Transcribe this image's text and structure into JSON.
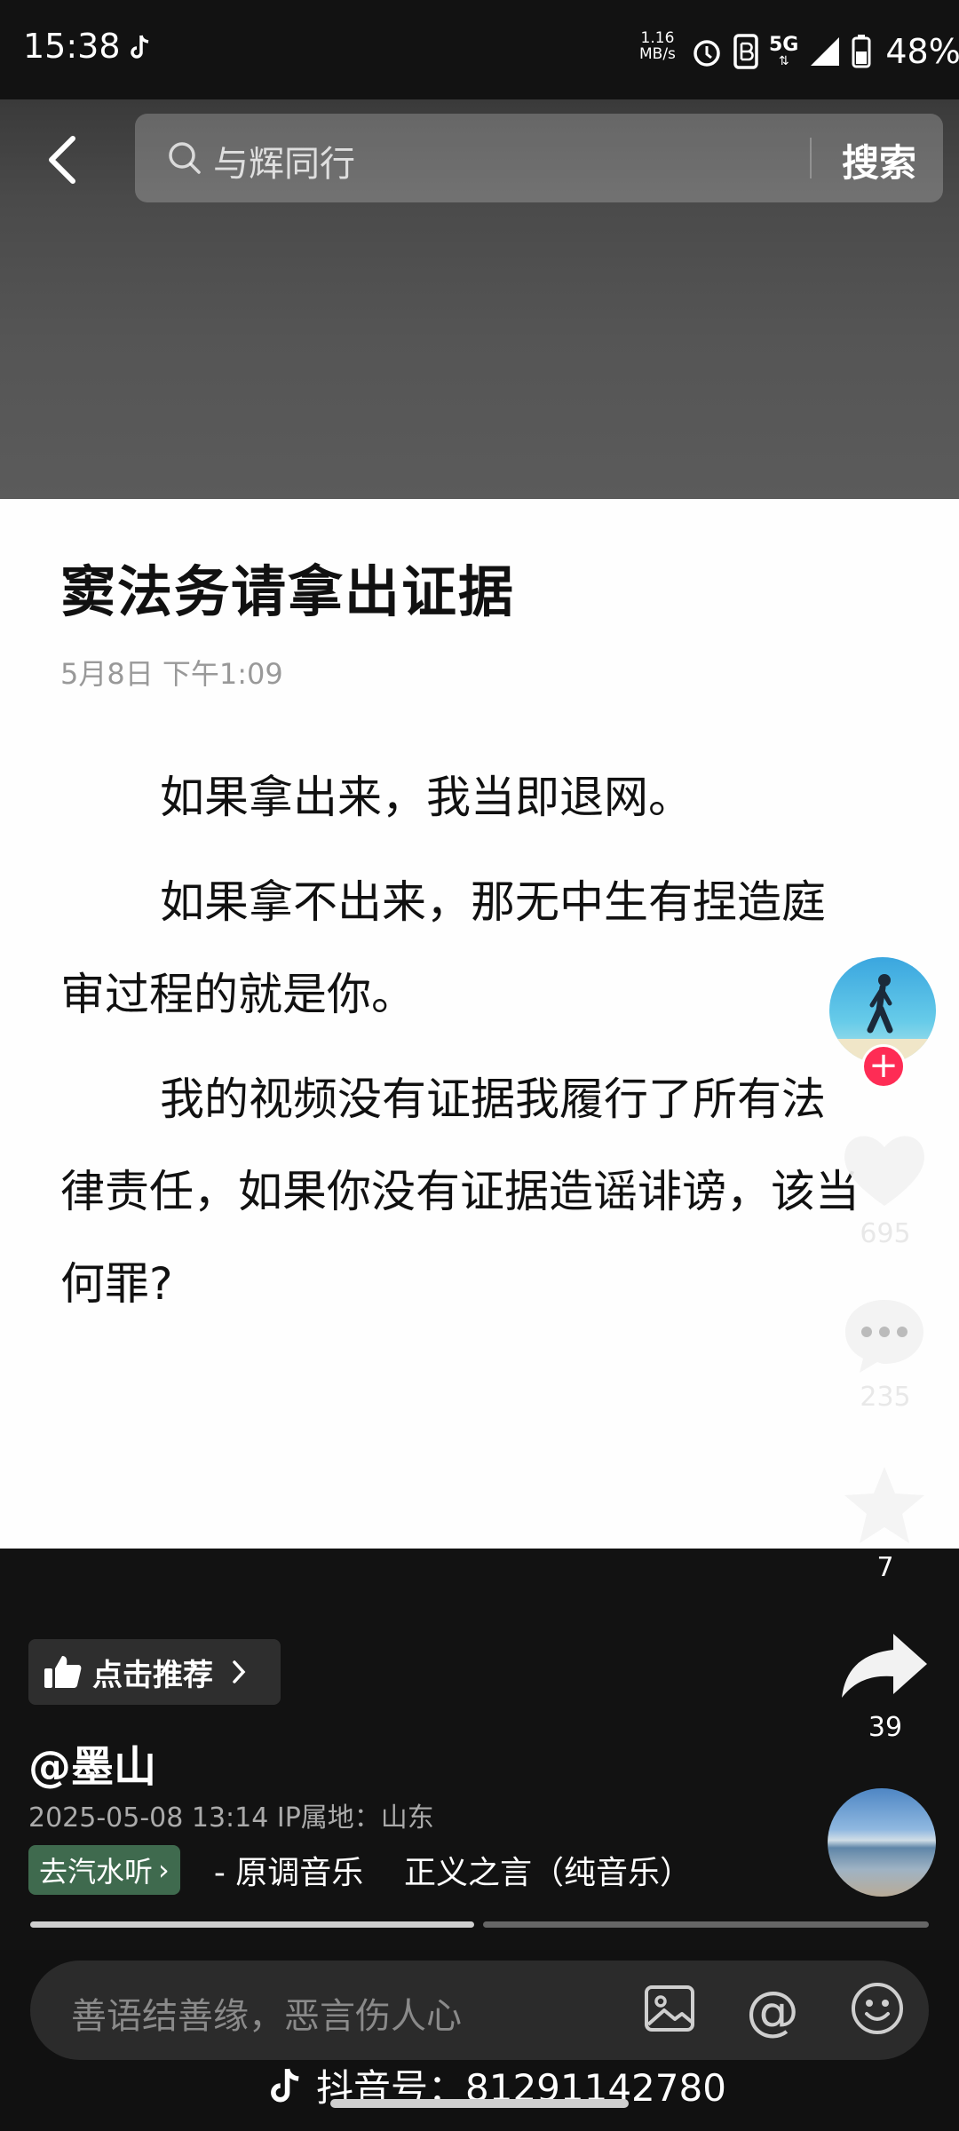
{
  "status_bar": {
    "time": "15:38",
    "speed_value": "1.16",
    "speed_unit": "MB/s",
    "network": "5G",
    "battery": "48%"
  },
  "search": {
    "query": "与辉同行",
    "button": "搜索"
  },
  "article": {
    "title": "窦法务请拿出证据",
    "date": "5月8日  下午1:09",
    "paragraphs": [
      "如果拿出来，我当即退网。",
      "如果拿不出来，那无中生有捏造庭审过程的就是你。",
      "我的视频没有证据我履行了所有法律责任，如果你没有证据造谣诽谤，该当何罪?"
    ]
  },
  "actions": {
    "likes": "695",
    "comments": "235",
    "favorites": "7",
    "shares": "39"
  },
  "video_info": {
    "recommend": "点击推荐",
    "username": "@墨山",
    "timestamp_location": "2025-05-08 13:14  IP属地：山东",
    "qishui_button": "去汽水听",
    "music": "- 原调音乐    正义之言（纯音乐）"
  },
  "comment_bar": {
    "placeholder": "善语结善缘，恶言伤人心"
  },
  "watermark": {
    "text": "抖音号：81291142780"
  },
  "progress": 0.49
}
